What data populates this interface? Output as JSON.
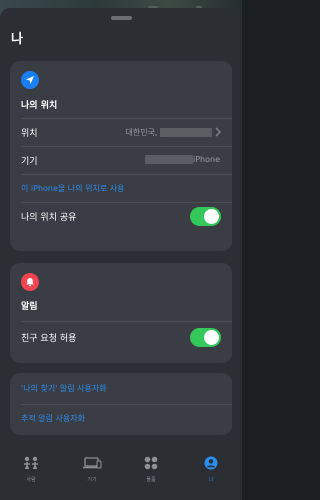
{
  "header": {
    "title": "나"
  },
  "location_card": {
    "section_title": "나의 위치",
    "location_row": {
      "label": "위치",
      "value": "대한민국,"
    },
    "device_row": {
      "label": "기기",
      "value": "iPhone"
    },
    "use_this_iphone_link": "이 iPhone을 나의 위치로 사용",
    "share_row": {
      "label": "나의 위치 공유",
      "toggle_on": true
    }
  },
  "alerts_card": {
    "section_title": "알림",
    "friend_requests_row": {
      "label": "친구 요청 허용",
      "toggle_on": true
    }
  },
  "links_card": {
    "findmy_alerts_link": "'나의 찾기' 알림 사용자화",
    "tracking_alerts_link": "추적 알림 사용자화"
  },
  "tabbar": {
    "tabs": [
      {
        "label": "사람",
        "icon": "people-icon"
      },
      {
        "label": "기기",
        "icon": "devices-icon"
      },
      {
        "label": "물품",
        "icon": "items-icon"
      },
      {
        "label": "나",
        "icon": "me-icon"
      }
    ],
    "active_index": 3
  },
  "colors": {
    "accent": "#2d8cf0",
    "toggle": "#34c759",
    "alert_badge": "#f04452",
    "location_badge": "#1a7ff0"
  }
}
